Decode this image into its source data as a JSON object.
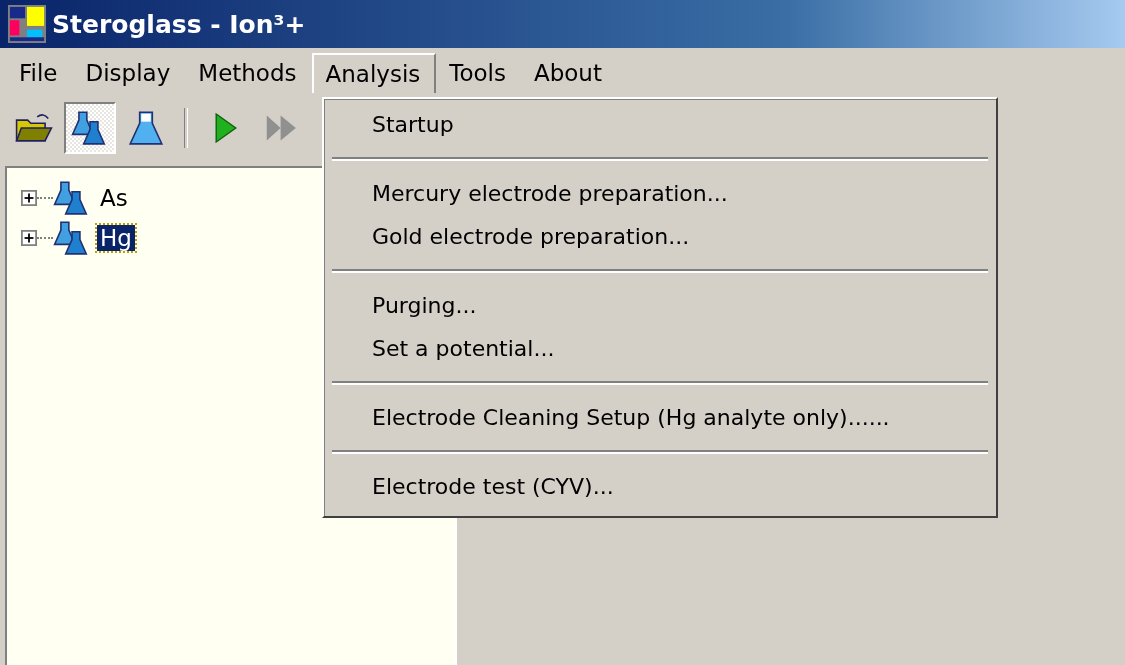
{
  "window": {
    "title": "Steroglass - Ion³+"
  },
  "menu_bar": [
    {
      "label": "File",
      "selected": false
    },
    {
      "label": "Display",
      "selected": false
    },
    {
      "label": "Methods",
      "selected": false
    },
    {
      "label": "Analysis",
      "selected": true
    },
    {
      "label": "Tools",
      "selected": false
    },
    {
      "label": "About",
      "selected": false
    }
  ],
  "toolbar": [
    {
      "kind": "open",
      "pressed": false,
      "disabled": false
    },
    {
      "kind": "flasks",
      "pressed": true,
      "disabled": false
    },
    {
      "kind": "flask",
      "pressed": false,
      "disabled": false
    },
    {
      "kind": "separator"
    },
    {
      "kind": "run",
      "pressed": false,
      "disabled": false
    },
    {
      "kind": "run_all",
      "pressed": false,
      "disabled": true
    }
  ],
  "tree": [
    {
      "label": "As",
      "expanded": false,
      "selected": false
    },
    {
      "label": "Hg",
      "expanded": false,
      "selected": true
    }
  ],
  "analysis_menu": [
    {
      "kind": "item",
      "label": "Startup"
    },
    {
      "kind": "separator"
    },
    {
      "kind": "item",
      "label": "Mercury electrode preparation..."
    },
    {
      "kind": "item",
      "label": "Gold electrode preparation..."
    },
    {
      "kind": "separator"
    },
    {
      "kind": "item",
      "label": "Purging..."
    },
    {
      "kind": "item",
      "label": "Set a potential..."
    },
    {
      "kind": "separator"
    },
    {
      "kind": "item",
      "label": "Electrode Cleaning Setup (Hg analyte only)......"
    },
    {
      "kind": "separator"
    },
    {
      "kind": "item",
      "label": "Electrode test (CYV)..."
    }
  ]
}
